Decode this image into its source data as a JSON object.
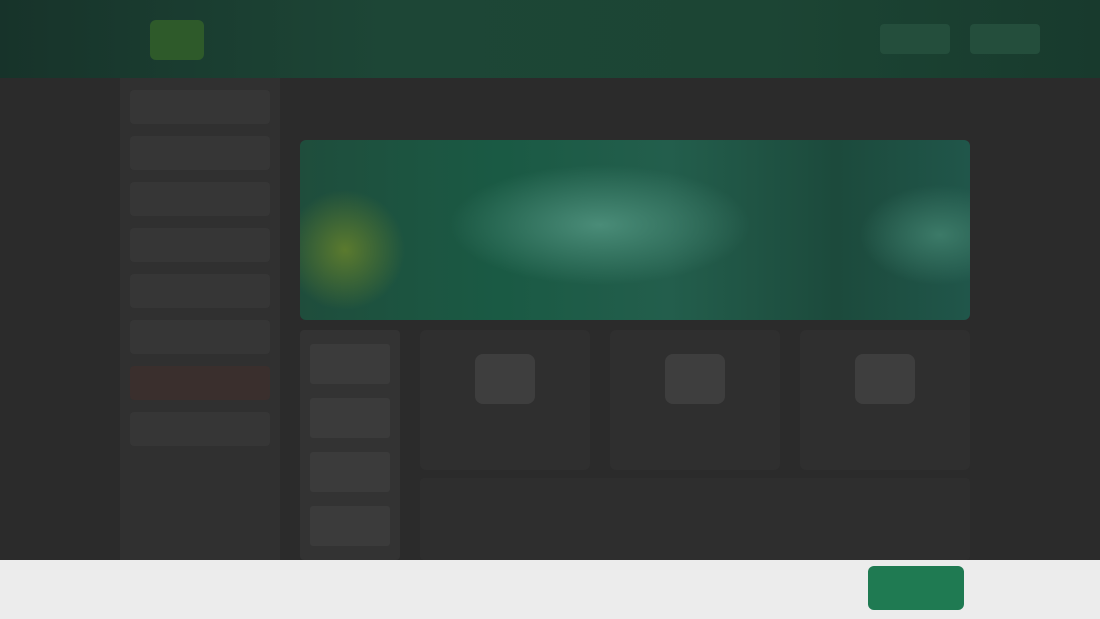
{
  "header": {
    "title": "",
    "buttons": [
      "",
      ""
    ]
  },
  "sidebar": {
    "items": [
      {
        "label": ""
      },
      {
        "label": ""
      },
      {
        "label": ""
      },
      {
        "label": ""
      },
      {
        "label": ""
      },
      {
        "label": ""
      },
      {
        "label": ""
      },
      {
        "label": ""
      }
    ]
  },
  "banner": {
    "title": "",
    "subtitle": ""
  },
  "side_column": {
    "items": [
      {
        "label": ""
      },
      {
        "label": ""
      },
      {
        "label": ""
      },
      {
        "label": ""
      }
    ]
  },
  "cards": [
    {
      "label": ""
    },
    {
      "label": ""
    },
    {
      "label": ""
    }
  ],
  "content": {
    "text": ""
  },
  "footer": {
    "button_label": ""
  },
  "colors": {
    "header_green": "#1d4636",
    "banner_green": "#1a5a44",
    "accent_green": "#1f7a52",
    "background": "#2b2b2b"
  }
}
